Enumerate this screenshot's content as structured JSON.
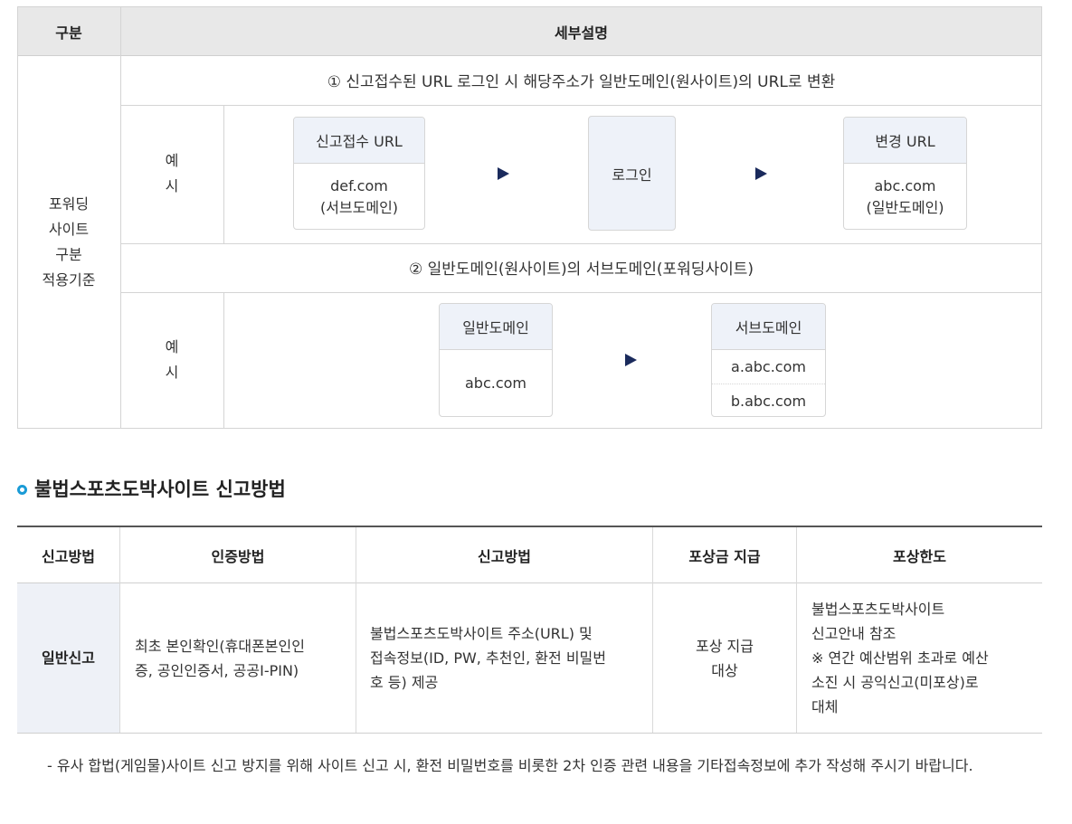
{
  "table1": {
    "header": {
      "col1": "구분",
      "col2": "세부설명"
    },
    "row_label": "포워딩\n사이트\n구분\n적용기준",
    "example_label": "예\n시",
    "section1": {
      "title": "① 신고접수된 URL 로그인 시 해당주소가 일반도메인(원사이트)의 URL로 변환",
      "box1": {
        "head": "신고접수 URL",
        "body": "def.com\n(서브도메인)"
      },
      "box2": {
        "text": "로그인"
      },
      "box3": {
        "head": "변경 URL",
        "body": "abc.com\n(일반도메인)"
      }
    },
    "section2": {
      "title": "② 일반도메인(원사이트)의 서브도메인(포워딩사이트)",
      "box1": {
        "head": "일반도메인",
        "body": "abc.com"
      },
      "box2": {
        "head": "서브도메인",
        "items": [
          "a.abc.com",
          "b.abc.com"
        ]
      }
    }
  },
  "section_title": "불법스포츠도박사이트 신고방법",
  "table2": {
    "headers": [
      "신고방법",
      "인증방법",
      "신고방법",
      "포상금 지급",
      "포상한도"
    ],
    "row": {
      "type": "일반신고",
      "auth": "최초 본인확인(휴대폰본인인\n증, 공인인증서, 공공I-PIN)",
      "method": "불법스포츠도박사이트 주소(URL) 및\n접속정보(ID, PW, 추천인, 환전 비밀번\n호 등) 제공",
      "reward": "포상 지급\n대상",
      "limit": "불법스포츠도박사이트\n신고안내 참조\n※ 연간 예산범위 초과로 예산\n소진 시 공익신고(미포상)로\n대체"
    }
  },
  "note": "- 유사 합법(게임물)사이트 신고 방지를 위해 사이트 신고 시, 환전 비밀번호를 비롯한 2차 인증 관련 내용을 기타접속정보에 추가 작성해 주시기 바랍니다.",
  "icons": {
    "arrow": "play-arrow-icon",
    "bullet": "ring-bullet-icon"
  },
  "colors": {
    "arrow": "#1a2a5c",
    "bullet": "#1a9bd6",
    "box_head": "#eef2f9"
  }
}
